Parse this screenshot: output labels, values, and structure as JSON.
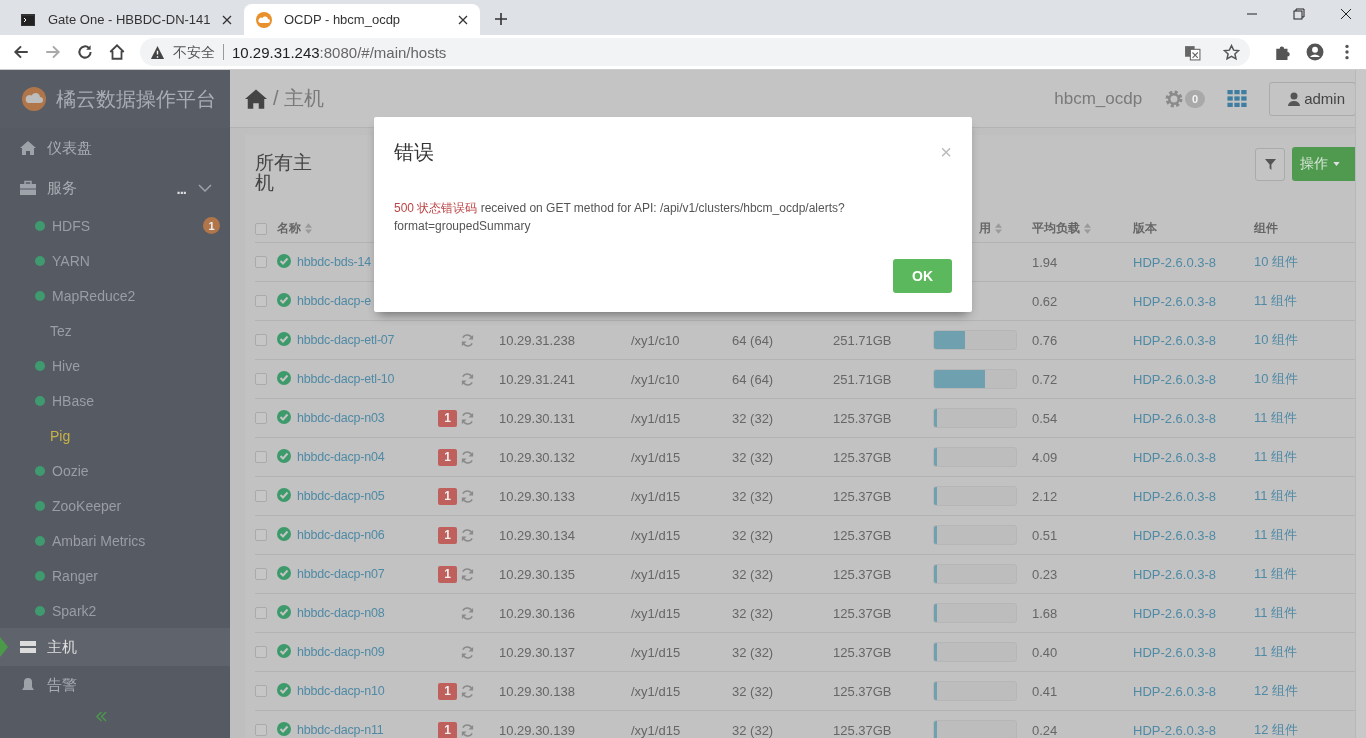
{
  "browser": {
    "tabs": [
      {
        "title": "Gate One - HBBDC-DN-141",
        "selected": false
      },
      {
        "title": "OCDP - hbcm_ocdp",
        "selected": true
      }
    ],
    "security": "不安全",
    "url_host": "10.29.31.243",
    "url_path": ":8080/#/main/hosts"
  },
  "sidebar": {
    "brand": "橘云数据操作平台",
    "items": [
      {
        "label": "仪表盘",
        "selected": false
      },
      {
        "label": "服务",
        "selected": false,
        "more": "...",
        "expanded": true
      }
    ],
    "services": [
      {
        "name": "HDFS",
        "dot": true,
        "selected": false,
        "badge": "1"
      },
      {
        "name": "YARN",
        "dot": true,
        "selected": false
      },
      {
        "name": "MapReduce2",
        "dot": true,
        "selected": false
      },
      {
        "name": "Tez",
        "dot": false,
        "selected": false
      },
      {
        "name": "Hive",
        "dot": true,
        "selected": false
      },
      {
        "name": "HBase",
        "dot": true,
        "selected": false
      },
      {
        "name": "Pig",
        "dot": false,
        "selected": true
      },
      {
        "name": "Oozie",
        "dot": true,
        "selected": false
      },
      {
        "name": "ZooKeeper",
        "dot": true,
        "selected": false
      },
      {
        "name": "Ambari Metrics",
        "dot": true,
        "selected": false
      },
      {
        "name": "Ranger",
        "dot": true,
        "selected": false
      },
      {
        "name": "Spark2",
        "dot": true,
        "selected": false
      }
    ],
    "bottom_items": [
      {
        "label": "主机",
        "selected": true
      },
      {
        "label": "告警",
        "selected": false
      }
    ]
  },
  "header": {
    "breadcrumb": "/ 主机",
    "cluster": "hbcm_ocdp",
    "ops_count": "0",
    "user": "admin"
  },
  "panel": {
    "title": "所有主机",
    "action": "操作"
  },
  "table": {
    "all_checked": false,
    "columns": [
      {
        "label": "名称",
        "sortable": true
      },
      {
        "label": "用",
        "sortable": true
      },
      {
        "label": "平均负载",
        "sortable": true
      },
      {
        "label": "版本",
        "sortable": false
      },
      {
        "label": "组件",
        "sortable": false
      }
    ],
    "rows": [
      {
        "checked": false,
        "name": "hbbdc-bds-14",
        "load": "1.94",
        "version": "HDP-2.6.0.3-8",
        "components": "10 组件"
      },
      {
        "checked": false,
        "name": "hbbdc-dacp-e",
        "load": "0.62",
        "version": "HDP-2.6.0.3-8",
        "components": "11 组件"
      },
      {
        "checked": false,
        "name": "hbbdc-dacp-etl-07",
        "stale": true,
        "ip": "10.29.31.238",
        "rack": "/xy1/c10",
        "cores": "64 (64)",
        "memory": "251.71GB",
        "level": 0.38,
        "load": "0.76",
        "version": "HDP-2.6.0.3-8",
        "components": "10 组件"
      },
      {
        "checked": false,
        "name": "hbbdc-dacp-etl-10",
        "stale": true,
        "ip": "10.29.31.241",
        "rack": "/xy1/c10",
        "cores": "64 (64)",
        "memory": "251.71GB",
        "level": 0.62,
        "load": "0.72",
        "version": "HDP-2.6.0.3-8",
        "components": "10 组件"
      },
      {
        "checked": false,
        "name": "hbbdc-dacp-n03",
        "alerts": "1",
        "stale": true,
        "ip": "10.29.30.131",
        "rack": "/xy1/d15",
        "cores": "32 (32)",
        "memory": "125.37GB",
        "level": 0.04,
        "load": "0.54",
        "version": "HDP-2.6.0.3-8",
        "components": "11 组件"
      },
      {
        "checked": false,
        "name": "hbbdc-dacp-n04",
        "alerts": "1",
        "stale": true,
        "ip": "10.29.30.132",
        "rack": "/xy1/d15",
        "cores": "32 (32)",
        "memory": "125.37GB",
        "level": 0.04,
        "load": "4.09",
        "version": "HDP-2.6.0.3-8",
        "components": "11 组件"
      },
      {
        "checked": false,
        "name": "hbbdc-dacp-n05",
        "alerts": "1",
        "stale": true,
        "ip": "10.29.30.133",
        "rack": "/xy1/d15",
        "cores": "32 (32)",
        "memory": "125.37GB",
        "level": 0.04,
        "load": "2.12",
        "version": "HDP-2.6.0.3-8",
        "components": "11 组件"
      },
      {
        "checked": false,
        "name": "hbbdc-dacp-n06",
        "alerts": "1",
        "stale": true,
        "ip": "10.29.30.134",
        "rack": "/xy1/d15",
        "cores": "32 (32)",
        "memory": "125.37GB",
        "level": 0.04,
        "load": "0.51",
        "version": "HDP-2.6.0.3-8",
        "components": "11 组件"
      },
      {
        "checked": false,
        "name": "hbbdc-dacp-n07",
        "alerts": "1",
        "stale": true,
        "ip": "10.29.30.135",
        "rack": "/xy1/d15",
        "cores": "32 (32)",
        "memory": "125.37GB",
        "level": 0.04,
        "load": "0.23",
        "version": "HDP-2.6.0.3-8",
        "components": "11 组件"
      },
      {
        "checked": false,
        "name": "hbbdc-dacp-n08",
        "stale": true,
        "ip": "10.29.30.136",
        "rack": "/xy1/d15",
        "cores": "32 (32)",
        "memory": "125.37GB",
        "level": 0.04,
        "load": "1.68",
        "version": "HDP-2.6.0.3-8",
        "components": "11 组件"
      },
      {
        "checked": false,
        "name": "hbbdc-dacp-n09",
        "stale": true,
        "ip": "10.29.30.137",
        "rack": "/xy1/d15",
        "cores": "32 (32)",
        "memory": "125.37GB",
        "level": 0.04,
        "load": "0.40",
        "version": "HDP-2.6.0.3-8",
        "components": "11 组件"
      },
      {
        "checked": false,
        "name": "hbbdc-dacp-n10",
        "alerts": "1",
        "stale": true,
        "ip": "10.29.30.138",
        "rack": "/xy1/d15",
        "cores": "32 (32)",
        "memory": "125.37GB",
        "level": 0.04,
        "load": "0.41",
        "version": "HDP-2.6.0.3-8",
        "components": "12 组件"
      },
      {
        "checked": false,
        "name": "hbbdc-dacp-n11",
        "alerts": "1",
        "stale": true,
        "ip": "10.29.30.139",
        "rack": "/xy1/d15",
        "cores": "32 (32)",
        "memory": "125.37GB",
        "level": 0.04,
        "load": "0.24",
        "version": "HDP-2.6.0.3-8",
        "components": "12 组件"
      }
    ]
  },
  "dialog": {
    "title": "错误",
    "close": "×",
    "error_code": "500 状态错误码",
    "message": "received on GET method for API: /api/v1/clusters/hbcm_ocdp/alerts?format=groupedSummary",
    "button": "OK"
  }
}
